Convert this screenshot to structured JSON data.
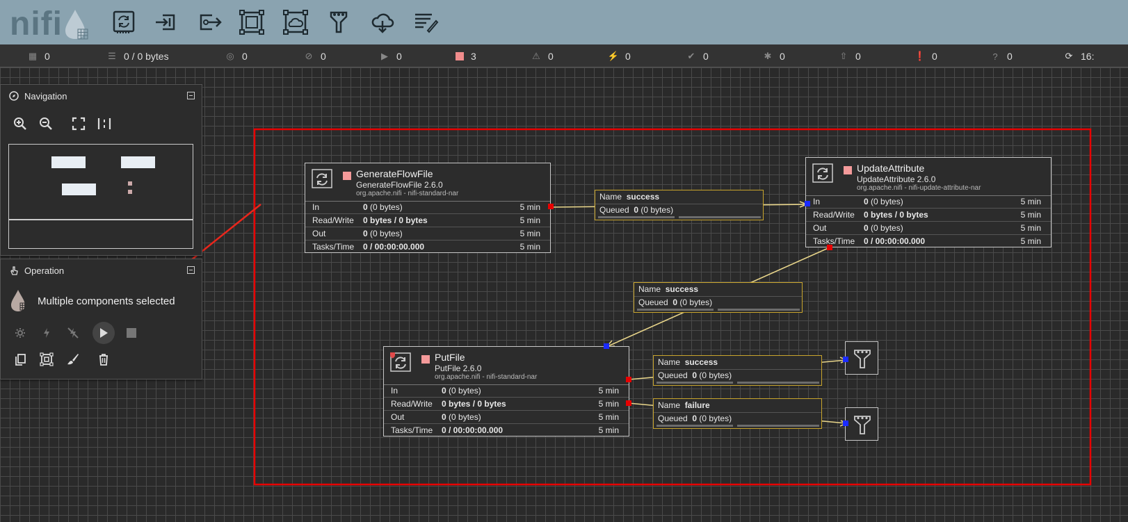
{
  "header": {
    "logo_text": "nifi",
    "toolbar": [
      {
        "name": "processor",
        "icon": "processor-icon"
      },
      {
        "name": "input-port",
        "icon": "input-port-icon"
      },
      {
        "name": "output-port",
        "icon": "output-port-icon"
      },
      {
        "name": "process-group",
        "icon": "process-group-icon"
      },
      {
        "name": "remote-process-group",
        "icon": "remote-process-group-icon"
      },
      {
        "name": "funnel",
        "icon": "funnel-icon"
      },
      {
        "name": "template",
        "icon": "template-icon"
      },
      {
        "name": "label",
        "icon": "label-icon"
      }
    ]
  },
  "status": {
    "active_threads": "0",
    "queued": "0 / 0 bytes",
    "transmitting": "0",
    "not_transmitting": "0",
    "running": "0",
    "stopped": "3",
    "invalid": "0",
    "disabled": "0",
    "up_to_date": "0",
    "locally_modified": "0",
    "stale": "0",
    "locally_modified_stale": "0",
    "sync_failure": "0",
    "last_refresh": "16:"
  },
  "navigation": {
    "title": "Navigation"
  },
  "operation": {
    "title": "Operation",
    "selection_text": "Multiple components selected"
  },
  "processors": [
    {
      "name": "GenerateFlowFile",
      "type": "GenerateFlowFile 2.6.0",
      "bundle": "org.apache.nifi - nifi-standard-nar",
      "rows": [
        {
          "label": "In",
          "value": "0",
          "extra": "(0 bytes)",
          "time": "5 min"
        },
        {
          "label": "Read/Write",
          "value": "0 bytes / 0 bytes",
          "extra": "",
          "time": "5 min"
        },
        {
          "label": "Out",
          "value": "0",
          "extra": "(0 bytes)",
          "time": "5 min"
        },
        {
          "label": "Tasks/Time",
          "value": "0 / 00:00:00.000",
          "extra": "",
          "time": "5 min"
        }
      ]
    },
    {
      "name": "UpdateAttribute",
      "type": "UpdateAttribute 2.6.0",
      "bundle": "org.apache.nifi - nifi-update-attribute-nar",
      "rows": [
        {
          "label": "In",
          "value": "0",
          "extra": "(0 bytes)",
          "time": "5 min"
        },
        {
          "label": "Read/Write",
          "value": "0 bytes / 0 bytes",
          "extra": "",
          "time": "5 min"
        },
        {
          "label": "Out",
          "value": "0",
          "extra": "(0 bytes)",
          "time": "5 min"
        },
        {
          "label": "Tasks/Time",
          "value": "0 / 00:00:00.000",
          "extra": "",
          "time": "5 min"
        }
      ]
    },
    {
      "name": "PutFile",
      "type": "PutFile 2.6.0",
      "bundle": "org.apache.nifi - nifi-standard-nar",
      "rows": [
        {
          "label": "In",
          "value": "0",
          "extra": "(0 bytes)",
          "time": "5 min"
        },
        {
          "label": "Read/Write",
          "value": "0 bytes / 0 bytes",
          "extra": "",
          "time": "5 min"
        },
        {
          "label": "Out",
          "value": "0",
          "extra": "(0 bytes)",
          "time": "5 min"
        },
        {
          "label": "Tasks/Time",
          "value": "0 / 00:00:00.000",
          "extra": "",
          "time": "5 min"
        }
      ]
    }
  ],
  "connections": [
    {
      "name_label": "Name",
      "name": "success",
      "queued_label": "Queued",
      "queued": "0",
      "queued_extra": "(0 bytes)"
    },
    {
      "name_label": "Name",
      "name": "success",
      "queued_label": "Queued",
      "queued": "0",
      "queued_extra": "(0 bytes)"
    },
    {
      "name_label": "Name",
      "name": "success",
      "queued_label": "Queued",
      "queued": "0",
      "queued_extra": "(0 bytes)"
    },
    {
      "name_label": "Name",
      "name": "failure",
      "queued_label": "Queued",
      "queued": "0",
      "queued_extra": "(0 bytes)"
    }
  ],
  "colors": {
    "header_bg": "#8aa3b0",
    "selection_box": "#e80000",
    "connection_border": "#c9a52c",
    "stopped_state": "#f49a9a"
  }
}
